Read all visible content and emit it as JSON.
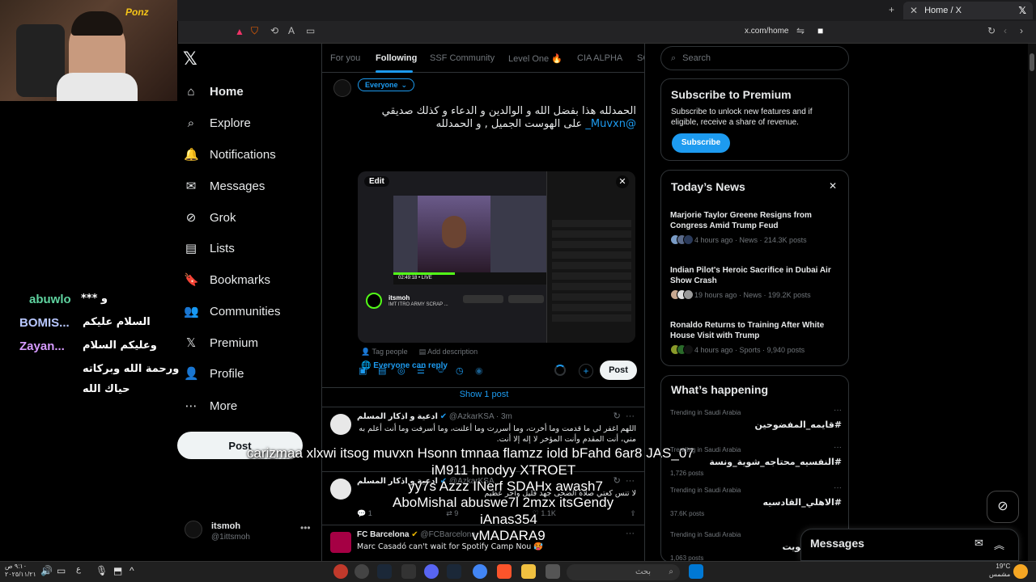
{
  "browser": {
    "tab_title": "Home / X",
    "url": "x.com/home"
  },
  "webcam": {
    "logo": "Ponz"
  },
  "nav": {
    "items": [
      {
        "label": "Home",
        "icon": "home-icon"
      },
      {
        "label": "Explore",
        "icon": "search-icon"
      },
      {
        "label": "Notifications",
        "icon": "bell-icon"
      },
      {
        "label": "Messages",
        "icon": "mail-icon"
      },
      {
        "label": "Grok",
        "icon": "grok-icon"
      },
      {
        "label": "Lists",
        "icon": "list-icon"
      },
      {
        "label": "Bookmarks",
        "icon": "bookmark-icon"
      },
      {
        "label": "Communities",
        "icon": "people-icon"
      },
      {
        "label": "Premium",
        "icon": "x-icon"
      },
      {
        "label": "Profile",
        "icon": "person-icon"
      },
      {
        "label": "More",
        "icon": "more-icon"
      }
    ],
    "post_label": "Post",
    "account": {
      "name": "itsmoh",
      "handle": "@1ittsmoh"
    }
  },
  "chat_overlay": [
    {
      "user": "abuwlo",
      "msg": "*** و",
      "color": "#5fd3a0"
    },
    {
      "user": "BOMIS...",
      "msg": "السلام عليكم",
      "color": "#b8c7ff"
    },
    {
      "user": "Zayan...",
      "msg": "وعليكم السلام",
      "color": "#d79bff"
    },
    {
      "user": "",
      "msg": "ورحمة الله وبركاته",
      "color": "#fff"
    },
    {
      "user": "",
      "msg": "حياك الله",
      "color": "#fff"
    }
  ],
  "feed_tabs": [
    "For you",
    "Following",
    "SSF Community",
    "Level One 🔥",
    "CIA ALPHA",
    "SC"
  ],
  "composer": {
    "audience": "Everyone",
    "text_line1": "الحمدلله هذا بفضل الله و الوالدين و الدعاء و كذلك صديقي",
    "mention": "@Muvxn_",
    "text_line2": " على الهوست الجميل , و الحمدلله",
    "media_edit": "Edit",
    "media_channel": "itsmoh",
    "media_title": "IMT ITRO ARMY SCRAP ...",
    "media_time": "02:49:18 • LIVE",
    "tag_people": "Tag people",
    "add_description": "Add description",
    "reply_setting": "Everyone can reply",
    "post_label": "Post"
  },
  "show_post": "Show 1 post",
  "tweets": [
    {
      "name": "ادعية و اذكار المسلم",
      "handle": "@AzkarKSA · 3m",
      "body": "اللهم اغفر لي ما قدمت وما أخرت، وما أسررت وما أعلنت، وما أسرفت وما أنت أعلم به مني، أنت المقدم وأنت المؤخر لا إله إلا أنت."
    },
    {
      "name": "ادعية و اذكار المسلم",
      "handle": "@AzkarKSA",
      "body": "لا تنس كعتي صلاة الضحى جهد قليل وأجر عظيم",
      "reply": "1",
      "retweet": "9",
      "likes": "1.1K"
    },
    {
      "name": "FC Barcelona",
      "handle": "@FCBarcelona",
      "body": "Marc Casadó can't wait for Spotify Camp Nou 🥵"
    }
  ],
  "stream_overlay": [
    "carizmaa xlxwi itsog muvxn Hsonn tmnaa flamzz iold bFahd 6ar8 JAS_07",
    "iM911 hnodyy XTROET",
    "yy7s Azzz INerf SDAHx awash7",
    "AboMishal abuswe7l 2mzx itsGendy",
    "iAnas354",
    "vMADARA9"
  ],
  "right": {
    "search_placeholder": "Search",
    "premium": {
      "title": "Subscribe to Premium",
      "text": "Subscribe to unlock new features and if eligible, receive a share of revenue.",
      "button": "Subscribe"
    },
    "news": {
      "title": "Today’s News",
      "items": [
        {
          "title": "Marjorie Taylor Greene Resigns from Congress Amid Trump Feud",
          "meta": "4 hours ago · News · 214.3K posts"
        },
        {
          "title": "Indian Pilot's Heroic Sacrifice in Dubai Air Show Crash",
          "meta": "19 hours ago · News · 199.2K posts"
        },
        {
          "title": "Ronaldo Returns to Training After White House Visit with Trump",
          "meta": "4 hours ago · Sports · 9,940 posts"
        }
      ]
    },
    "happening": {
      "title": "What’s happening",
      "trends": [
        {
          "label": "Trending in Saudi Arabia",
          "tag": "#قايمه_المفضوحين",
          "count": ""
        },
        {
          "label": "Trending in Saudi Arabia",
          "tag": "#النفسيه_محتاجه_شوية_ونسة",
          "count": "1,726 posts"
        },
        {
          "label": "Trending in Saudi Arabia",
          "tag": "#الاهلي_القادسيه",
          "count": "37.6K posts"
        },
        {
          "label": "Trending in Saudi Arabia",
          "tag": "#نصر_الكويت",
          "count": "1,063 posts"
        }
      ]
    },
    "messages_title": "Messages"
  },
  "taskbar": {
    "time": "٩:١٠ ص",
    "date": "٢٠٢٥/١١/٢١",
    "lang": "ع",
    "search_placeholder": "بحث",
    "weather_temp": "19°C",
    "weather_text": "مشمس"
  }
}
